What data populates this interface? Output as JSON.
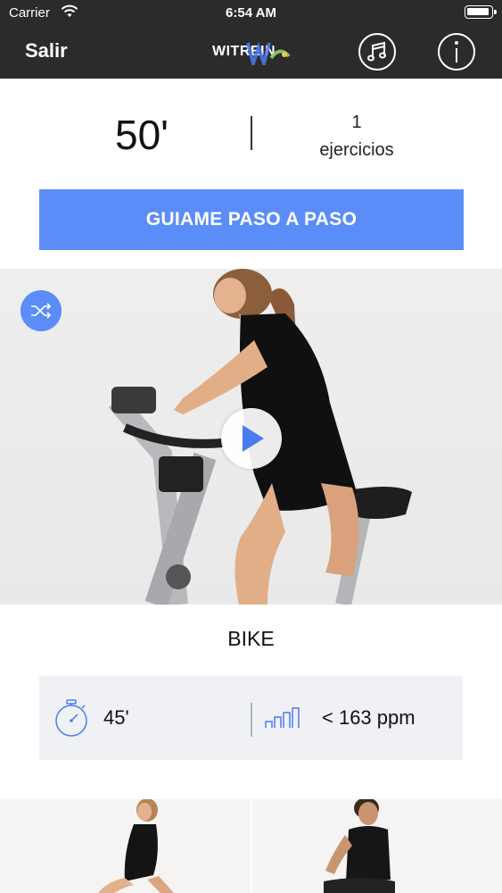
{
  "status_bar": {
    "carrier": "Carrier",
    "time": "6:54 AM"
  },
  "nav": {
    "exit_label": "Salir",
    "brand": "WITREIN",
    "music_icon": "music-note-icon",
    "info_icon": "info-icon"
  },
  "summary": {
    "duration": "50'",
    "exercise_count": "1",
    "exercise_label": "ejercicios"
  },
  "guide_button": "GUIAME PASO A PASO",
  "exercise": {
    "name": "BIKE",
    "time": "45'",
    "heart_rate": "< 163 ppm"
  },
  "colors": {
    "accent": "#5b8df8",
    "nav_bg": "#2b2b2b",
    "stats_bg": "#f0f1f5"
  }
}
